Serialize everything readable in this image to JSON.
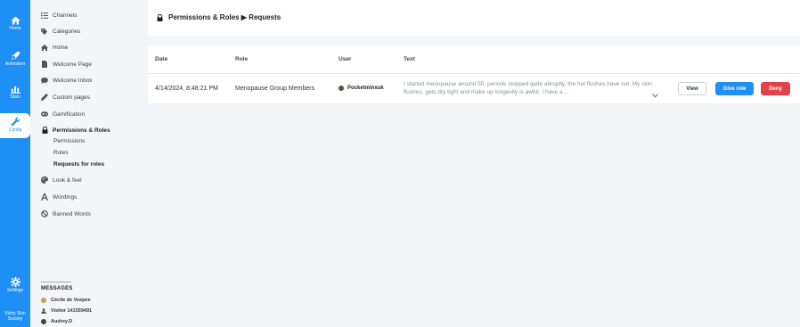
{
  "rail": {
    "items": [
      {
        "label": "Home",
        "icon": "home-icon"
      },
      {
        "label": "Animation",
        "icon": "rocket-icon"
      },
      {
        "label": "Stats",
        "icon": "bar-chart-icon"
      },
      {
        "label": "Config",
        "icon": "wrench-icon"
      },
      {
        "label": "Settings",
        "icon": "gear-icon"
      }
    ],
    "org_name": "Vichy Skin Society",
    "active": "Config"
  },
  "sidebar": {
    "items": [
      {
        "label": "Channels",
        "icon": "list-icon"
      },
      {
        "label": "Categories",
        "icon": "tags-icon"
      },
      {
        "label": "Home",
        "icon": "home-icon"
      },
      {
        "label": "Welcome Page",
        "icon": "file-icon"
      },
      {
        "label": "Welcome Inbox",
        "icon": "chat-bubble-icon"
      },
      {
        "label": "Custom pages",
        "icon": "pencil-icon"
      },
      {
        "label": "Gamification",
        "icon": "gamepad-icon"
      },
      {
        "label": "Permissions & Roles",
        "icon": "lock-icon"
      },
      {
        "label": "Look & feel",
        "icon": "palette-icon"
      },
      {
        "label": "Wordings",
        "icon": "font-icon"
      },
      {
        "label": "Banned Words",
        "icon": "ban-icon"
      }
    ],
    "sub_items": [
      {
        "label": "Permissions"
      },
      {
        "label": "Roles"
      },
      {
        "label": "Requests for roles"
      }
    ],
    "messages": {
      "title": "MESSAGES",
      "items": [
        {
          "name": "Cécile de Veepee"
        },
        {
          "name": "Visitor 141559491"
        },
        {
          "name": "Audrey.D"
        }
      ]
    }
  },
  "header": {
    "title": "Permissions & Roles ▶ Requests"
  },
  "table": {
    "columns": [
      "Date",
      "Role",
      "User",
      "Text"
    ],
    "rows": [
      {
        "date": "4/14/2024, 8:48:21 PM",
        "role": "Menopause Group Members",
        "user": "Pocketminxuk",
        "text": "I started menopause around 50, periods stopped quite abruptly, the hot flushes have not. My skin flushes, gets dry tight and make up longevity is awful. I have a ...",
        "view_label": "View",
        "give_label": "Give role",
        "deny_label": "Deny"
      }
    ]
  },
  "colors": {
    "accent": "#1e8ff5",
    "deny": "#e2404a",
    "background": "#f4f5f8"
  }
}
